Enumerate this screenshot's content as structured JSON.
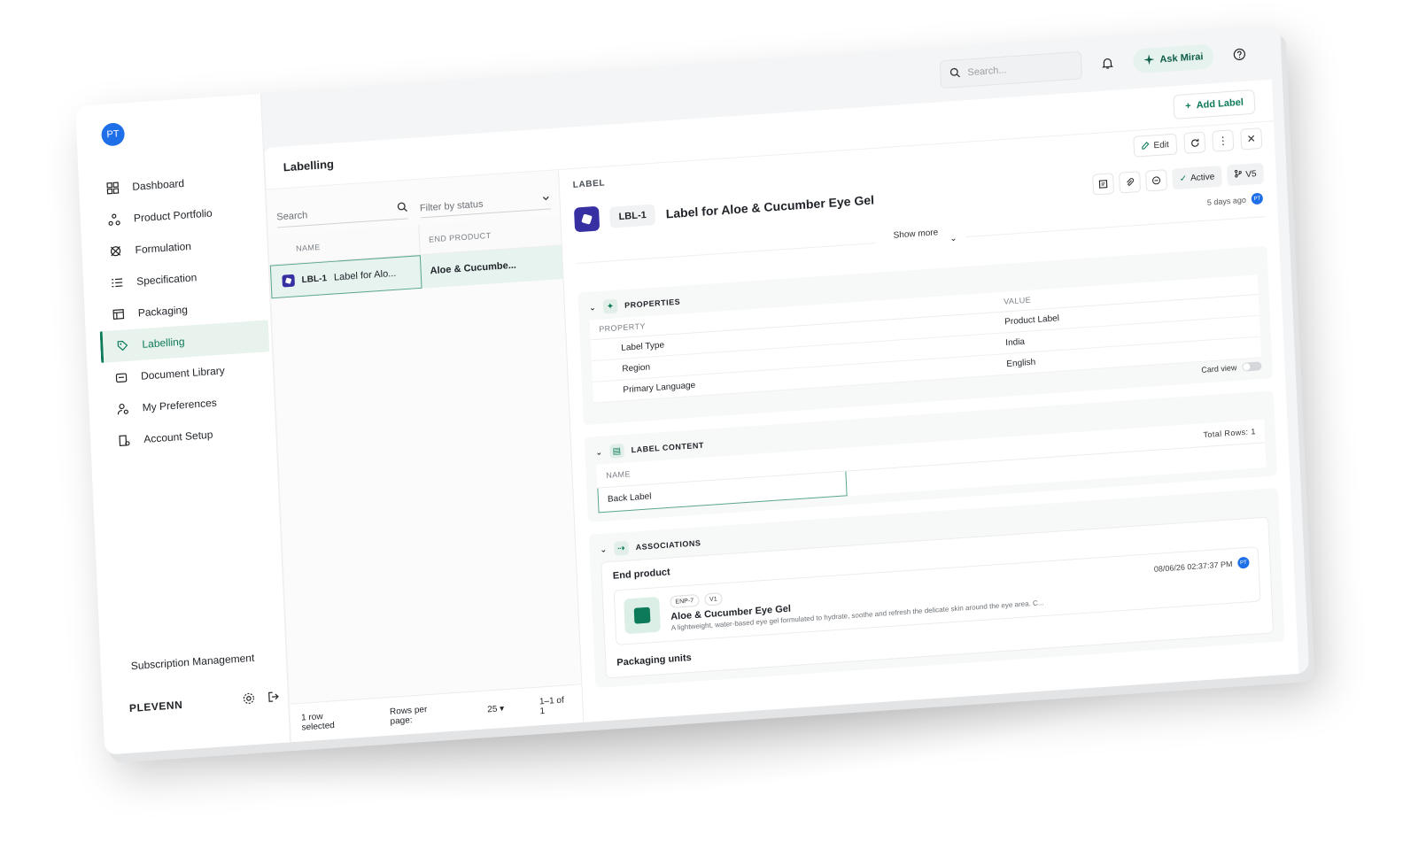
{
  "topbar": {
    "search_placeholder": "Search...",
    "ask_label": "Ask Mirai"
  },
  "sidebar": {
    "avatar_initials": "PT",
    "items": [
      {
        "label": "Dashboard",
        "icon": "grid-icon"
      },
      {
        "label": "Product Portfolio",
        "icon": "nodes-icon"
      },
      {
        "label": "Formulation",
        "icon": "formula-icon"
      },
      {
        "label": "Specification",
        "icon": "list-icon"
      },
      {
        "label": "Packaging",
        "icon": "box-icon"
      },
      {
        "label": "Labelling",
        "icon": "tag-icon",
        "active": true
      },
      {
        "label": "Document Library",
        "icon": "folder-icon"
      },
      {
        "label": "My Preferences",
        "icon": "user-gear-icon"
      },
      {
        "label": "Account Setup",
        "icon": "building-icon"
      }
    ],
    "subscription_label": "Subscription Management",
    "org_name": "PLEVENN"
  },
  "main": {
    "title": "Labelling",
    "add_label": "Add Label"
  },
  "list": {
    "search_placeholder": "Search",
    "filter_placeholder": "Filter by status",
    "columns": [
      "NAME",
      "END PRODUCT"
    ],
    "rows": [
      {
        "code": "LBL-1",
        "name": "Label for Alo...",
        "end_product": "Aloe & Cucumbe..."
      }
    ],
    "selected_text": "1 row selected",
    "rows_per_page_label": "Rows per page:",
    "rows_per_page": "25",
    "range": "1–1 of 1"
  },
  "detail": {
    "kicker": "LABEL",
    "edit_label": "Edit",
    "code": "LBL-1",
    "title": "Label for Aloe & Cucumber Eye Gel",
    "status": "Active",
    "version": "V5",
    "updated": "5 days ago",
    "updated_by": "PT",
    "show_more": "Show more",
    "properties": {
      "heading": "PROPERTIES",
      "col_property": "PROPERTY",
      "col_value": "VALUE",
      "rows": [
        {
          "k": "Label Type",
          "v": "Product Label"
        },
        {
          "k": "Region",
          "v": "India"
        },
        {
          "k": "Primary Language",
          "v": "English"
        }
      ],
      "card_view": "Card view"
    },
    "label_content": {
      "heading": "LABEL CONTENT",
      "col_name": "NAME",
      "total_rows": "Total Rows: 1",
      "rows": [
        "Back Label"
      ]
    },
    "associations": {
      "heading": "ASSOCIATIONS",
      "end_product_title": "End product",
      "ep_code": "ENP-7",
      "ep_version": "V1",
      "ep_name": "Aloe & Cucumber Eye Gel",
      "ep_desc": "A lightweight, water-based eye gel formulated to hydrate, soothe and refresh the delicate skin around the eye area. C...",
      "ep_date": "08/06/26 02:37:37 PM",
      "ep_by": "PT",
      "packaging_units": "Packaging units"
    }
  }
}
